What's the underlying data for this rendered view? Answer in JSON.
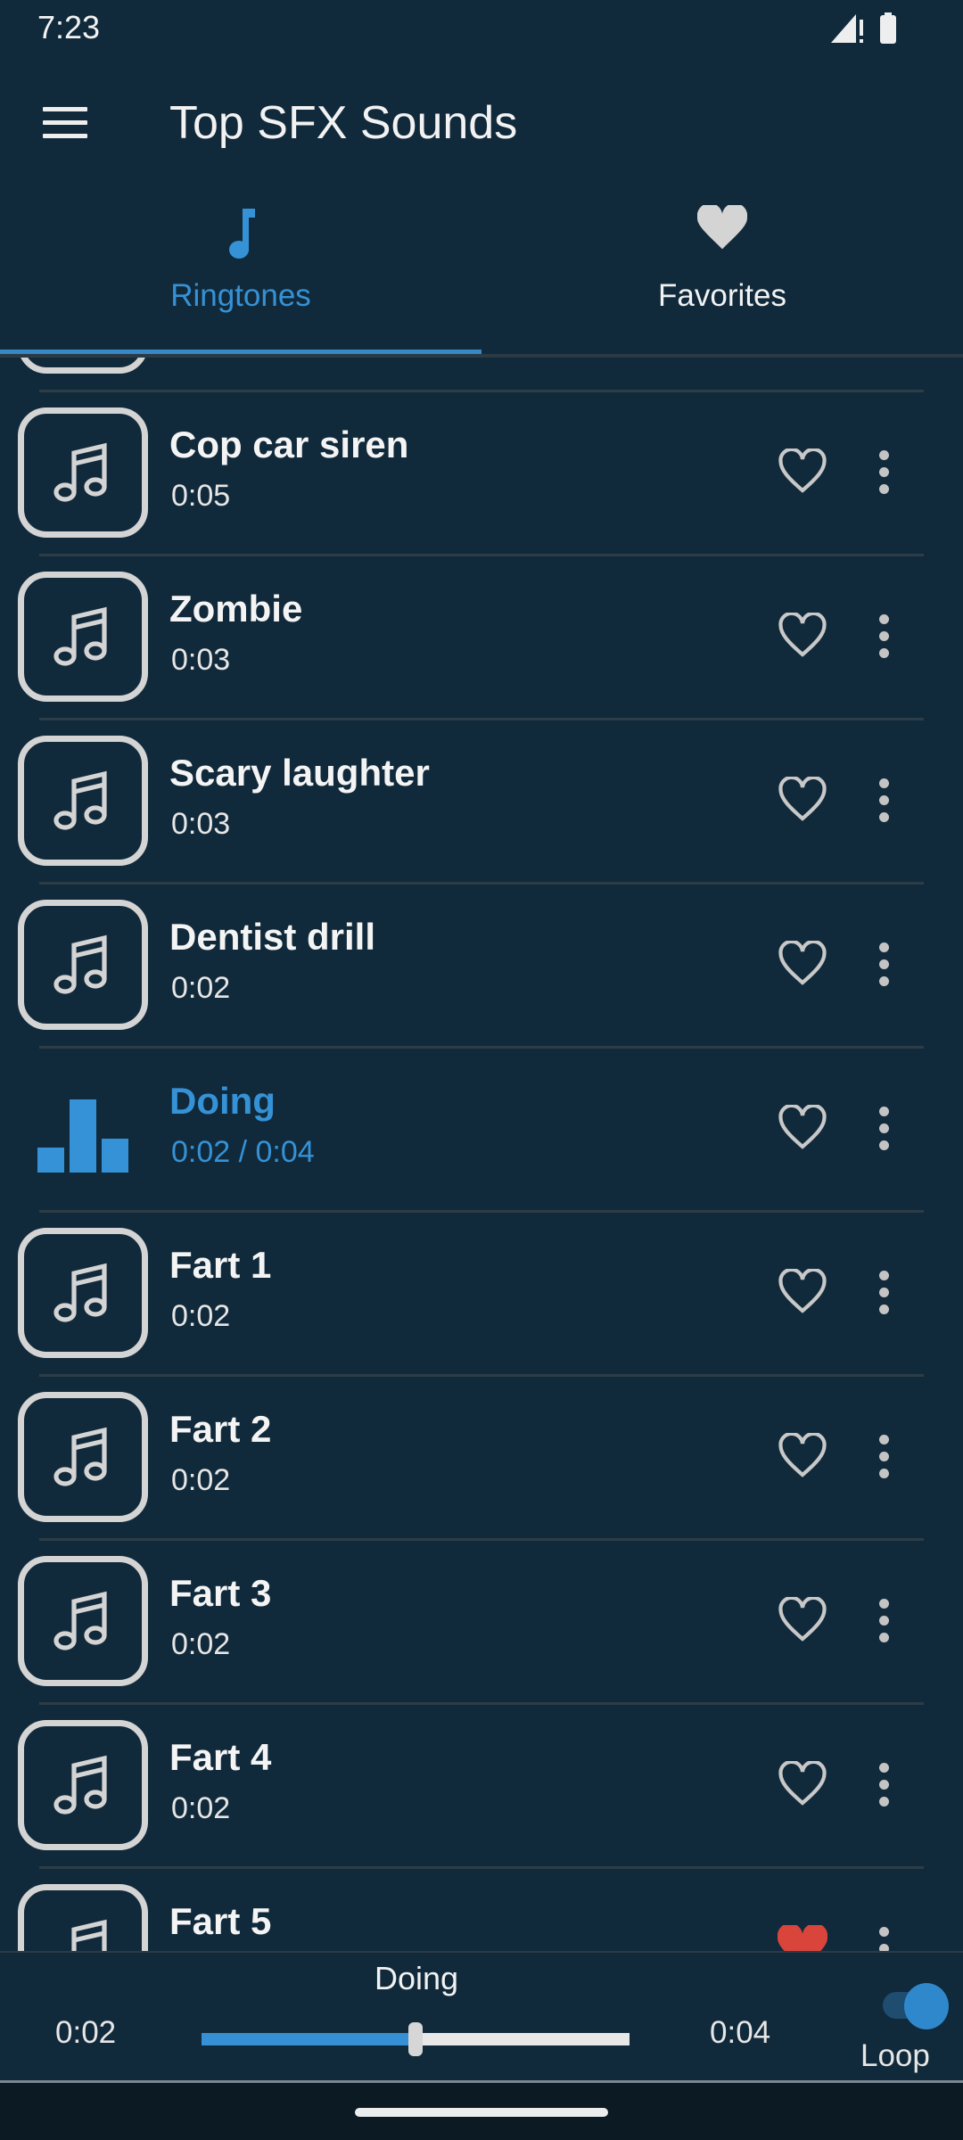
{
  "status_bar": {
    "time": "7:23",
    "icons": [
      "signal-icon",
      "battery-icon"
    ]
  },
  "app_bar": {
    "title": "Top SFX Sounds",
    "menu_icon": "hamburger-menu-icon"
  },
  "tabs": [
    {
      "label": "Ringtones",
      "icon": "music-note-icon",
      "active": true
    },
    {
      "label": "Favorites",
      "icon": "heart-icon",
      "active": false
    }
  ],
  "colors": {
    "accent": "#3592d6",
    "background": "#112a3b",
    "favorite": "#d9453b"
  },
  "list": [
    {
      "title": "Cop car siren",
      "duration": "0:05",
      "favorite": false
    },
    {
      "title": "Zombie",
      "duration": "0:03",
      "favorite": false
    },
    {
      "title": "Scary laughter",
      "duration": "0:03",
      "favorite": false
    },
    {
      "title": "Dentist drill",
      "duration": "0:02",
      "favorite": false
    },
    {
      "title": "Doing",
      "duration": "0:02 /  0:04",
      "favorite": false,
      "playing": true
    },
    {
      "title": "Fart 1",
      "duration": "0:02",
      "favorite": false
    },
    {
      "title": "Fart 2",
      "duration": "0:02",
      "favorite": false
    },
    {
      "title": "Fart 3",
      "duration": "0:02",
      "favorite": false
    },
    {
      "title": "Fart 4",
      "duration": "0:02",
      "favorite": false
    },
    {
      "title": "Fart 5",
      "duration": "",
      "favorite": true
    }
  ],
  "player": {
    "title": "Doing",
    "current": "0:02",
    "total": "0:04",
    "progress_percent": 50,
    "loop_label": "Loop",
    "loop_on": true
  }
}
